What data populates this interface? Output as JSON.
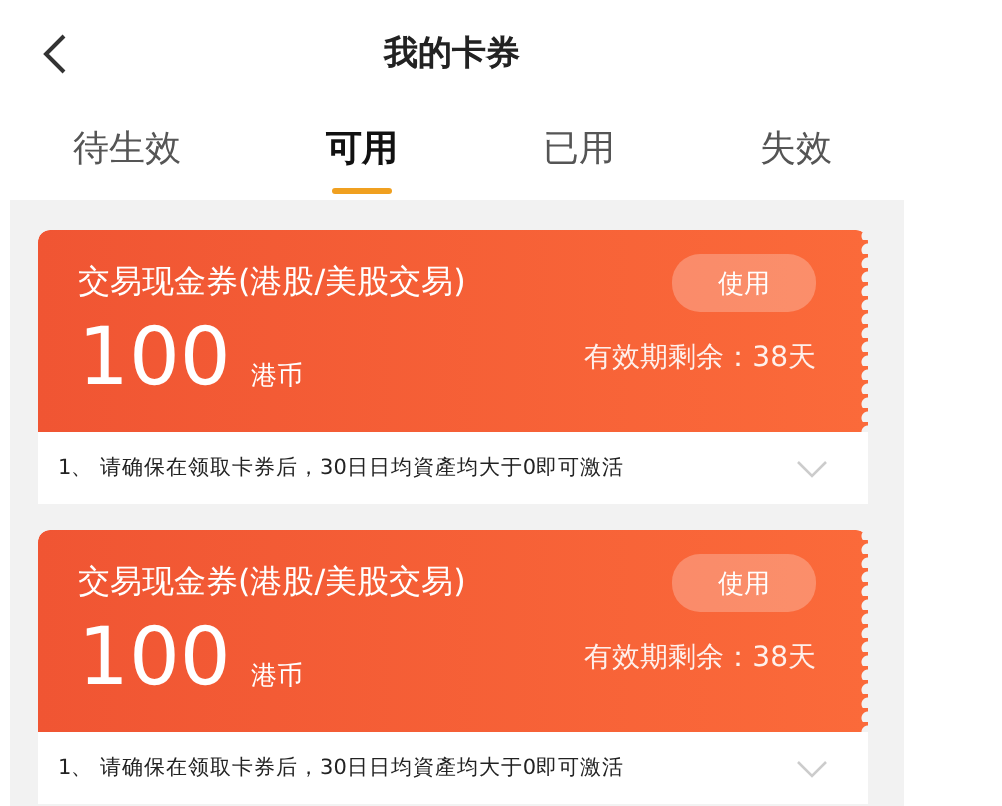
{
  "header": {
    "title": "我的卡券"
  },
  "tabs": [
    {
      "label": "待生效",
      "selected": false
    },
    {
      "label": "可用",
      "selected": true
    },
    {
      "label": "已用",
      "selected": false
    },
    {
      "label": "失效",
      "selected": false
    }
  ],
  "coupons": [
    {
      "title": "交易现金券(港股/美股交易)",
      "amount": "100",
      "unit": "港币",
      "button": "使用",
      "validity": "有效期剩余：38天",
      "note": "1、 请确保在领取卡券后，30日日均資產均大于0即可激活"
    },
    {
      "title": "交易现金券(港股/美股交易)",
      "amount": "100",
      "unit": "港币",
      "button": "使用",
      "validity": "有效期剩余：38天",
      "note": "1、 请确保在领取卡券后，30日日均資產均大于0即可激活"
    }
  ]
}
